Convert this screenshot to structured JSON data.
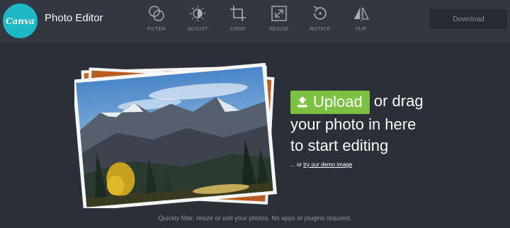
{
  "header": {
    "logo_text": "Canva",
    "title": "Photo Editor",
    "tools": [
      {
        "label": "FILTER",
        "icon": "filter-icon"
      },
      {
        "label": "ADJUST",
        "icon": "adjust-icon"
      },
      {
        "label": "CROP",
        "icon": "crop-icon"
      },
      {
        "label": "RESIZE",
        "icon": "resize-icon"
      },
      {
        "label": "ROTATE",
        "icon": "rotate-icon"
      },
      {
        "label": "FLIP",
        "icon": "flip-icon"
      }
    ],
    "download_label": "Download"
  },
  "main": {
    "upload_label": "Upload",
    "upload_text_1": "or drag",
    "upload_text_2": "your photo in here",
    "upload_text_3": "to start editing",
    "demo_prefix": "... or",
    "demo_link": "try our demo image"
  },
  "footer": {
    "text": "Quickly filter, resize or edit your photos. No apps or plugins required."
  },
  "colors": {
    "background": "#2a2f38",
    "topbar": "#323741",
    "logo": "#1fb8c6",
    "upload_button": "#7bc142",
    "download_button": "#262a31"
  }
}
